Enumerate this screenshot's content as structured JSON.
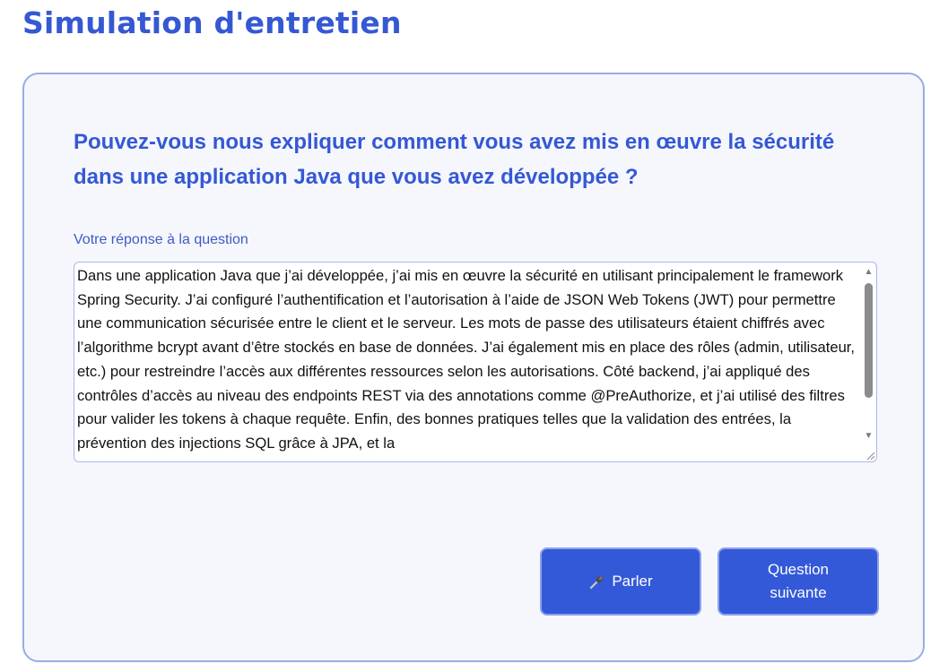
{
  "page": {
    "title": "Simulation d'entretien"
  },
  "interview": {
    "question": "Pouvez-vous nous expliquer comment vous avez mis en œuvre la sécurité dans une application Java que vous avez développée ?",
    "answer_label": "Votre réponse à la question",
    "answer_value": "Dans une application Java que j’ai développée, j’ai mis en œuvre la sécurité en utilisant principalement le framework Spring Security. J’ai configuré l’authentification et l’autorisation à l’aide de JSON Web Tokens (JWT) pour permettre une communication sécurisée entre le client et le serveur. Les mots de passe des utilisateurs étaient chiffrés avec l’algorithme bcrypt avant d’être stockés en base de données. J’ai également mis en place des rôles (admin, utilisateur, etc.) pour restreindre l’accès aux différentes ressources selon les autorisations. Côté backend, j’ai appliqué des contrôles d’accès au niveau des endpoints REST via des annotations comme @PreAuthorize, et j’ai utilisé des filtres pour valider les tokens à chaque requête. Enfin, des bonnes pratiques telles que la validation des entrées, la prévention des injections SQL grâce à JPA, et la"
  },
  "actions": {
    "speak_label": "Parler",
    "speak_icon": "microphone-icon",
    "next_label": "Question suivante"
  },
  "colors": {
    "brand": "#3558d4",
    "button": "#3459d8",
    "card_background": "#f5f7fd",
    "card_border": "#9aabe6"
  }
}
